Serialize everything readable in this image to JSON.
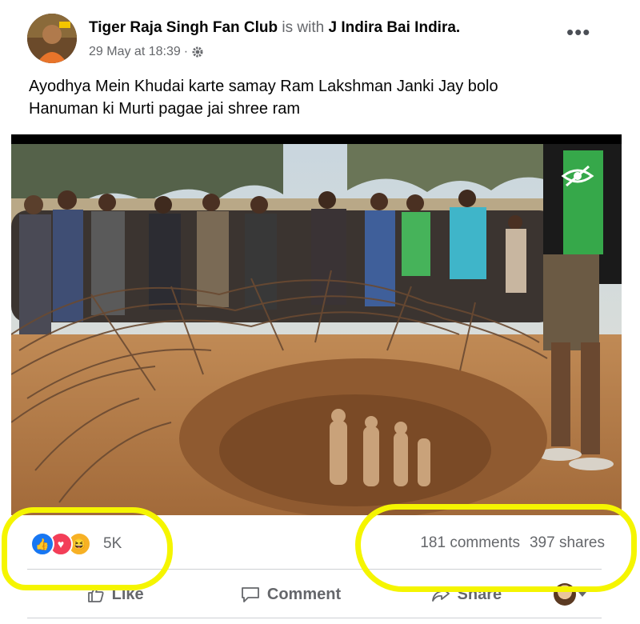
{
  "post": {
    "author": "Tiger Raja Singh Fan Club",
    "with_text": "is with",
    "tagged": "J Indira Bai Indira",
    "timestamp": "29 May at 18:39",
    "separator": "·",
    "privacy_icon": "gear-icon",
    "more_icon": "more-options-icon",
    "text_line1": "Ayodhya Mein Khudai karte samay Ram Lakshman Janki Jay bolo",
    "text_line2": "Hanuman ki Murti pagae jai shree ram"
  },
  "engagement": {
    "reaction_icons": [
      "like-reaction-icon",
      "love-reaction-icon",
      "haha-reaction-icon"
    ],
    "reaction_count": "5K",
    "comments": "181 comments",
    "shares": "397 shares"
  },
  "actions": {
    "like": "Like",
    "comment": "Comment",
    "share": "Share"
  },
  "colors": {
    "highlight": "#f5f500",
    "like_blue": "#1877f2",
    "love_red": "#f33e58",
    "haha_yellow": "#f7b125",
    "muted_text": "#65676b"
  }
}
